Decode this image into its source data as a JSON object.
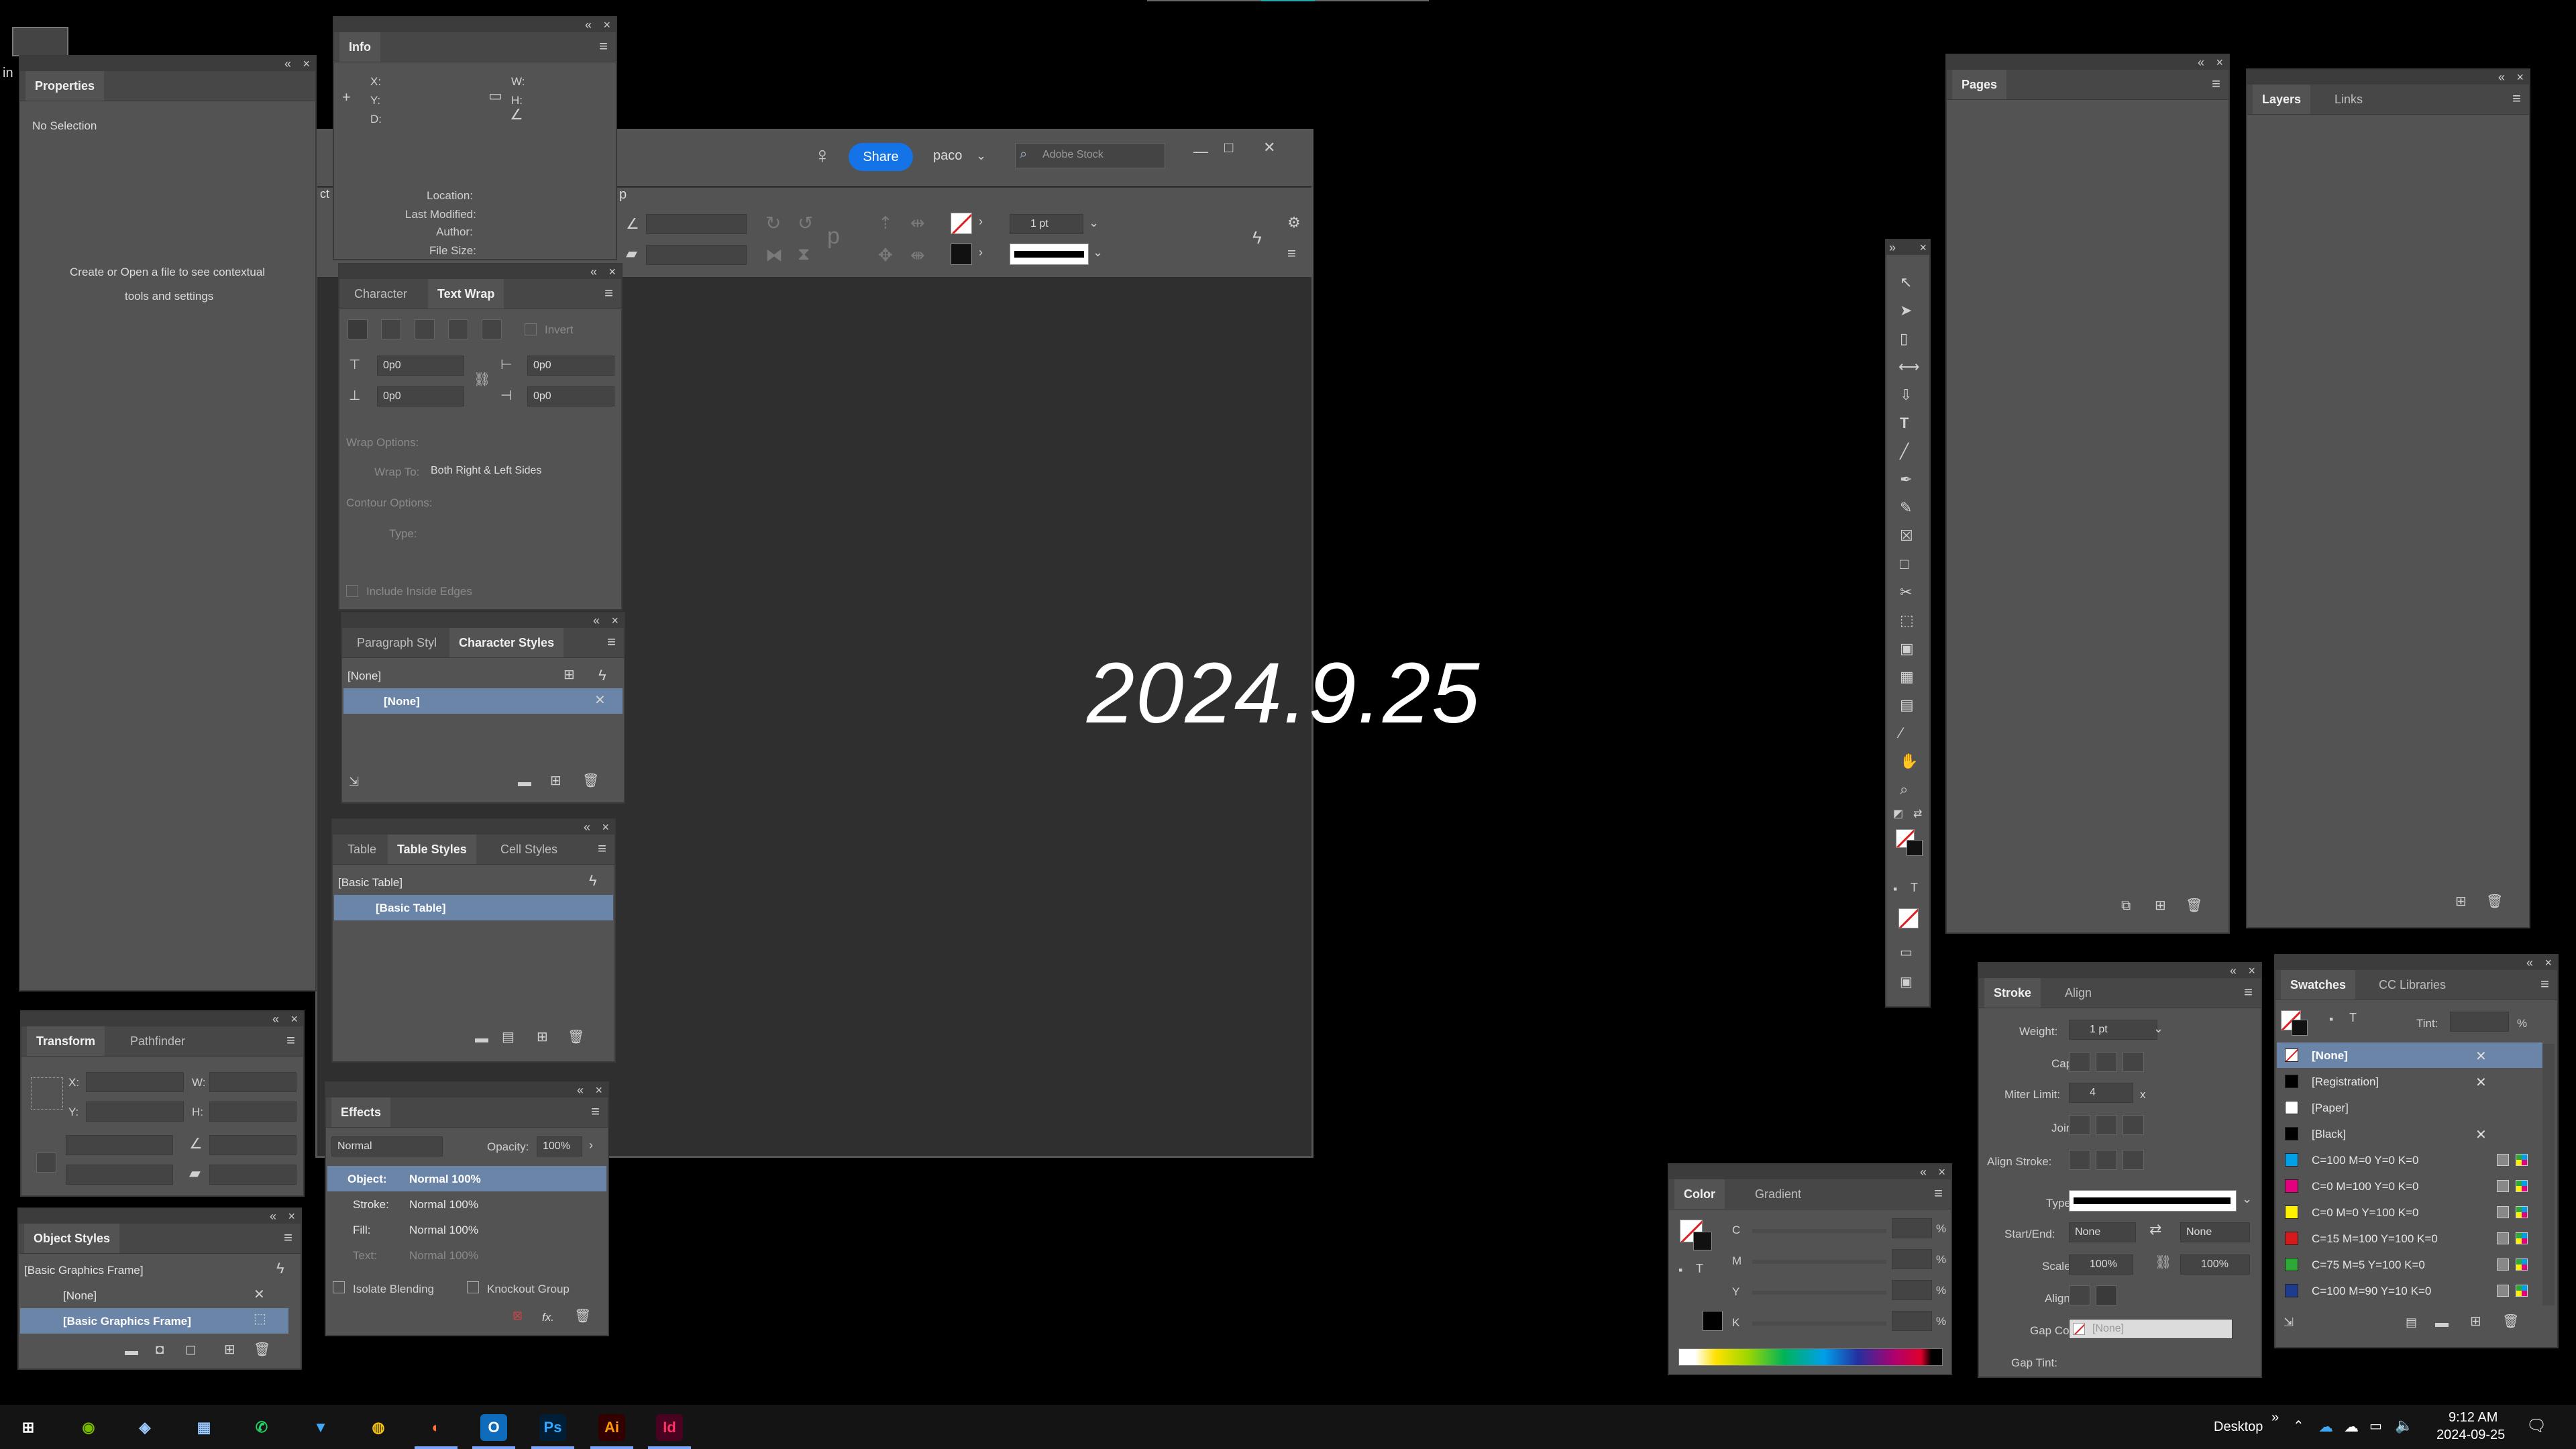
{
  "desktop_corner": "in",
  "top_bar": {
    "accent": "#1473e6"
  },
  "main_window": {
    "share_label": "Share",
    "user_label": "paco",
    "stock_placeholder": "Adobe Stock",
    "stroke_weight": "1 pt",
    "partial_left": "ct",
    "partial_p": "p"
  },
  "date_overlay": "2024.9.25",
  "properties": {
    "tab": "Properties",
    "status": "No Selection",
    "hint_line1": "Create or Open a file to see contextual",
    "hint_line2": "tools and settings"
  },
  "info": {
    "tab": "Info",
    "x_label": "X:",
    "y_label": "Y:",
    "d_label": "D:",
    "w_label": "W:",
    "h_label": "H:",
    "meta": [
      "Location:",
      "Last Modified:",
      "Author:",
      "File Size:"
    ]
  },
  "text_wrap": {
    "tabs": [
      "Character",
      "Text Wrap"
    ],
    "invert_label": "Invert",
    "offset_top": "0p0",
    "offset_bottom": "0p0",
    "offset_left": "0p0",
    "offset_right": "0p0",
    "wrap_options_label": "Wrap Options:",
    "wrap_to_label": "Wrap To:",
    "wrap_to_value": "Both Right & Left Sides",
    "contour_label": "Contour Options:",
    "type_label": "Type:",
    "include_edges_label": "Include Inside Edges"
  },
  "char_styles": {
    "tabs": [
      "Paragraph Styl",
      "Character Styles"
    ],
    "header": "[None]",
    "selected": "[None]"
  },
  "table_styles": {
    "tabs": [
      "Table",
      "Table Styles",
      "Cell Styles"
    ],
    "header": "[Basic Table]",
    "selected": "[Basic Table]"
  },
  "transform": {
    "tabs": [
      "Transform",
      "Pathfinder"
    ],
    "x_label": "X:",
    "y_label": "Y:",
    "w_label": "W:",
    "h_label": "H:"
  },
  "object_styles": {
    "tab": "Object Styles",
    "header": "[Basic Graphics Frame]",
    "items": [
      "[None]",
      "[Basic Graphics Frame]"
    ]
  },
  "effects": {
    "tab": "Effects",
    "mode": "Normal",
    "opacity_label": "Opacity:",
    "opacity": "100%",
    "rows": [
      {
        "label": "Object:",
        "value": "Normal 100%"
      },
      {
        "label": "Stroke:",
        "value": "Normal 100%"
      },
      {
        "label": "Fill:",
        "value": "Normal 100%"
      },
      {
        "label": "Text:",
        "value": "Normal 100%"
      }
    ],
    "isolate_label": "Isolate Blending",
    "knockout_label": "Knockout Group",
    "fx": "fx."
  },
  "pages": {
    "tab": "Pages"
  },
  "layers": {
    "tabs": [
      "Layers",
      "Links"
    ]
  },
  "color": {
    "tabs": [
      "Color",
      "Gradient"
    ],
    "channels": [
      "C",
      "M",
      "Y",
      "K"
    ],
    "pct": "%"
  },
  "stroke": {
    "tabs": [
      "Stroke",
      "Align"
    ],
    "weight_label": "Weight:",
    "weight": "1 pt",
    "cap_label": "Cap:",
    "miter_label": "Miter Limit:",
    "miter": "4",
    "miter_x": "x",
    "join_label": "Join:",
    "align_stroke_label": "Align Stroke:",
    "type_label": "Type:",
    "start_end_label": "Start/End:",
    "start": "None",
    "end": "None",
    "scale_label": "Scale:",
    "scale_start": "100%",
    "scale_end": "100%",
    "align_label": "Align:",
    "gap_color_label": "Gap Color:",
    "gap_color": "[None]",
    "gap_tint_label": "Gap Tint:"
  },
  "swatches": {
    "tabs": [
      "Swatches",
      "CC Libraries"
    ],
    "tint_label": "Tint:",
    "tint_pct": "%",
    "items": [
      {
        "name": "[None]",
        "color": "none"
      },
      {
        "name": "[Registration]",
        "color": "#000000"
      },
      {
        "name": "[Paper]",
        "color": "#ffffff"
      },
      {
        "name": "[Black]",
        "color": "#000000"
      },
      {
        "name": "C=100 M=0 Y=0 K=0",
        "color": "#00a0e9"
      },
      {
        "name": "C=0 M=100 Y=0 K=0",
        "color": "#e4007f"
      },
      {
        "name": "C=0 M=0 Y=100 K=0",
        "color": "#fff100"
      },
      {
        "name": "C=15 M=100 Y=100 K=0",
        "color": "#d7191c"
      },
      {
        "name": "C=75 M=5 Y=100 K=0",
        "color": "#2ea836"
      },
      {
        "name": "C=100 M=90 Y=10 K=0",
        "color": "#1d3c8f"
      }
    ]
  },
  "taskbar": {
    "desktop_label": "Desktop",
    "chevron": "»",
    "time": "9:12 AM",
    "date": "2024-09-25",
    "apps": [
      {
        "icon": "windows-icon",
        "glyph": "⊞",
        "color": "#ffffff",
        "bg": "transparent"
      },
      {
        "icon": "nvidia-icon",
        "glyph": "◉",
        "color": "#76b900",
        "bg": "transparent"
      },
      {
        "icon": "copilot-icon",
        "glyph": "◈",
        "color": "#9ecbff",
        "bg": "transparent"
      },
      {
        "icon": "calculator-icon",
        "glyph": "▦",
        "color": "#9ecbff",
        "bg": "transparent"
      },
      {
        "icon": "whatsapp-icon",
        "glyph": "✆",
        "color": "#25d366",
        "bg": "transparent"
      },
      {
        "icon": "vpn-icon",
        "glyph": "▼",
        "color": "#3fa9f5",
        "bg": "transparent"
      },
      {
        "icon": "chrome-icon",
        "glyph": "◍",
        "color": "#f4c20d",
        "bg": "transparent"
      },
      {
        "icon": "firefox-icon",
        "glyph": "◐",
        "color": "#ff7139",
        "bg": "transparent"
      },
      {
        "icon": "outlook-icon",
        "glyph": "O",
        "color": "#ffffff",
        "bg": "#0f6cbd"
      },
      {
        "icon": "photoshop-icon",
        "glyph": "Ps",
        "color": "#31a8ff",
        "bg": "#001e36"
      },
      {
        "icon": "illustrator-icon",
        "glyph": "Ai",
        "color": "#ff9a00",
        "bg": "#330000"
      },
      {
        "icon": "indesign-icon",
        "glyph": "Id",
        "color": "#ff3366",
        "bg": "#49021f"
      }
    ]
  }
}
